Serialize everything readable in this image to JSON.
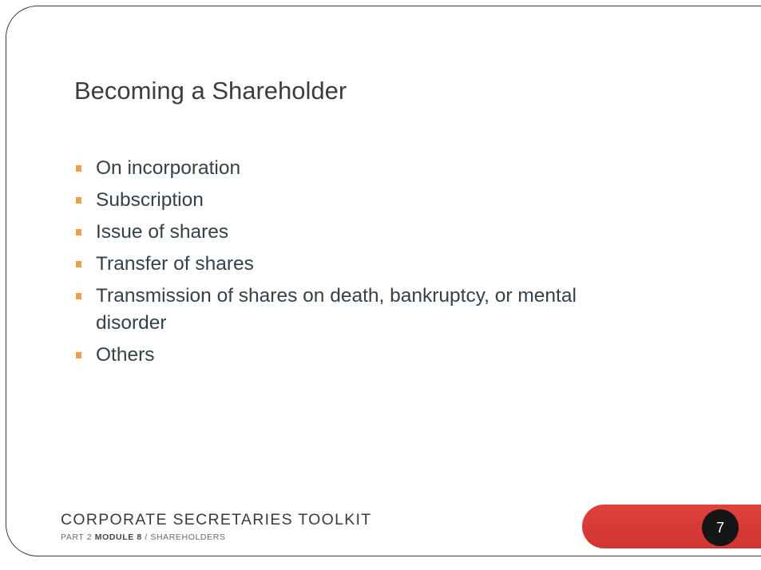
{
  "slide": {
    "title": "Becoming a Shareholder",
    "bullets": [
      "On incorporation",
      "Subscription",
      "Issue of shares",
      "Transfer of shares",
      "Transmission of shares on death, bankruptcy, or mental disorder",
      "Others"
    ]
  },
  "footer": {
    "toolkit_title": "CORPORATE SECRETARIES TOOLKIT",
    "part_label": "PART 2",
    "module_label": "MODULE 8",
    "section_label": "/ SHAREHOLDERS",
    "page_number": "7"
  },
  "colors": {
    "bullet_marker": "#e8a04a",
    "accent_bar": "#d83a36",
    "page_badge": "#161616",
    "title_text": "#3d3d3d",
    "body_text": "#33424a"
  }
}
